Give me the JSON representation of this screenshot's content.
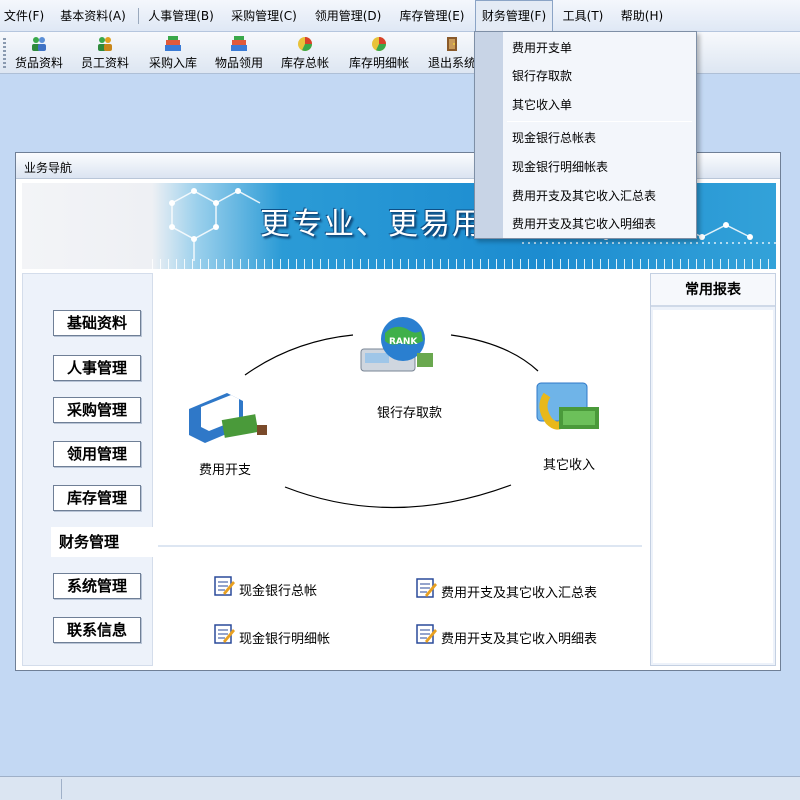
{
  "menubar": {
    "items": [
      "文件(F)",
      "基本资料(A)",
      "人事管理(B)",
      "采购管理(C)",
      "领用管理(D)",
      "库存管理(E)",
      "财务管理(F)",
      "工具(T)",
      "帮助(H)"
    ],
    "active_index": 6
  },
  "toolbar": {
    "buttons": [
      {
        "label": "货品资料",
        "icon": "users-icon"
      },
      {
        "label": "员工资料",
        "icon": "users-icon"
      },
      {
        "label": "采购入库",
        "icon": "books-icon"
      },
      {
        "label": "物品领用",
        "icon": "books-icon"
      },
      {
        "label": "库存总帐",
        "icon": "pie-chart-icon"
      },
      {
        "label": "库存明细帐",
        "icon": "pie-chart-icon"
      },
      {
        "label": "退出系统",
        "icon": "door-exit-icon"
      }
    ]
  },
  "dropdown": {
    "items": [
      "费用开支单",
      "银行存取款",
      "其它收入单",
      "现金银行总帐表",
      "现金银行明细帐表",
      "费用开支及其它收入汇总表",
      "费用开支及其它收入明细表"
    ]
  },
  "window": {
    "title": "业务导航",
    "banner_text": "更专业、更易用"
  },
  "nav": {
    "items": [
      "基础资料",
      "人事管理",
      "采购管理",
      "领用管理",
      "库存管理",
      "财务管理",
      "系统管理",
      "联系信息"
    ],
    "active_index": 5
  },
  "flow": {
    "bank": "银行存取款",
    "expense": "费用开支",
    "income": "其它收入",
    "globe_text": "RANK"
  },
  "reports": [
    "现金银行总帐",
    "费用开支及其它收入汇总表",
    "现金银行明细帐",
    "费用开支及其它收入明细表"
  ],
  "right_panel": {
    "title": "常用报表"
  },
  "colors": {
    "background": "#c3d8f3",
    "banner_blue": "#1c8cd0",
    "panel": "#edf2fa",
    "menu_active": "#e4ebf5"
  }
}
